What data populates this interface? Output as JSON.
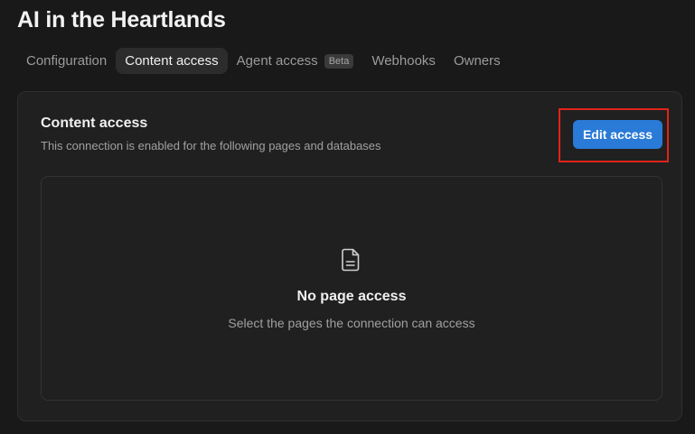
{
  "page": {
    "title": "AI in the Heartlands"
  },
  "tabs": [
    {
      "label": "Configuration",
      "active": false
    },
    {
      "label": "Content access",
      "active": true
    },
    {
      "label": "Agent access",
      "badge": "Beta",
      "active": false
    },
    {
      "label": "Webhooks",
      "active": false
    },
    {
      "label": "Owners",
      "active": false
    }
  ],
  "content_access": {
    "title": "Content access",
    "description": "This connection is enabled for the following pages and databases",
    "edit_button_label": "Edit access",
    "empty_state": {
      "icon": "document-icon",
      "title": "No page access",
      "description": "Select the pages the connection can access"
    }
  },
  "colors": {
    "background": "#191919",
    "card": "#202020",
    "accent_button": "#2a7ad7",
    "highlight_box": "#e0241a"
  }
}
